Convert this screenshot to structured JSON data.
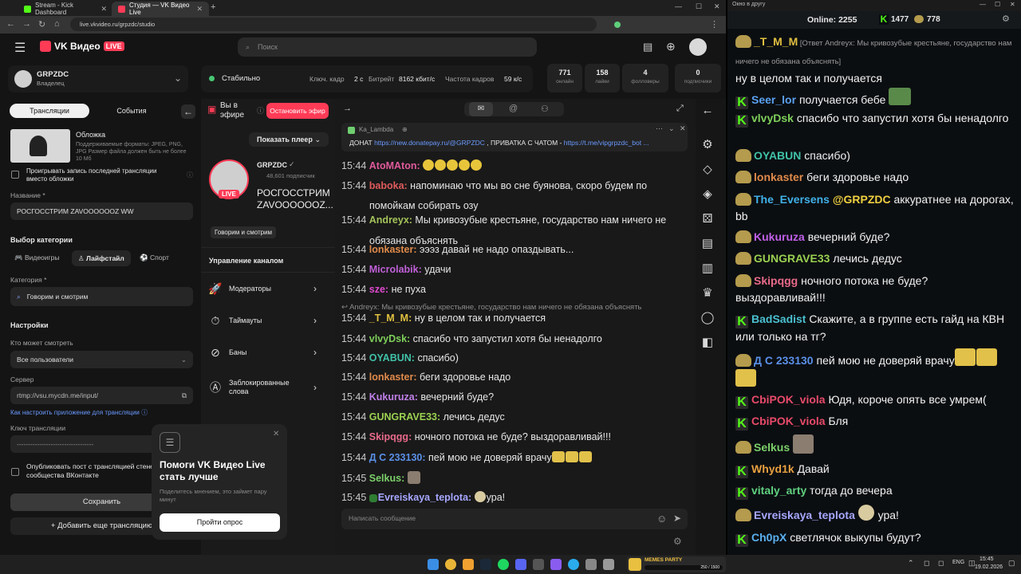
{
  "browser": {
    "tabs": [
      {
        "title": "Stream - Kick Dashboard",
        "color": "#53fc18"
      },
      {
        "title": "Студия — VK Видео Live",
        "color": "#ff3b56"
      }
    ],
    "url": "live.vkvideo.ru/grpzdc/studio"
  },
  "header": {
    "logo_text": "VK Видео",
    "live_badge": "LIVE",
    "search_placeholder": "Поиск"
  },
  "channel_card": {
    "name": "GRPZDC",
    "role": "Владелец"
  },
  "status": {
    "state": "Стабильно",
    "keyframe_label": "Ключ. кадр",
    "keyframe_value": "2 с",
    "bitrate_label": "Битрейт",
    "bitrate_value": "8162 кбит/с",
    "fps_label": "Частота кадров",
    "fps_value": "59 к/с"
  },
  "stats": [
    {
      "value": "771",
      "label": "онлайн"
    },
    {
      "value": "158",
      "label": "лайки"
    },
    {
      "value": "4",
      "label": "фолловеры"
    },
    {
      "value": "0",
      "label": "подписчики"
    }
  ],
  "left": {
    "tab_streams": "Трансляции",
    "tab_events": "События",
    "cover_title": "Обложка",
    "cover_desc": "Поддерживаемые форматы: JPEG, PNG, JPG Размер файла должен быть не более 10 Мб",
    "replay_checkbox": "Проигрывать запись последней трансляции вместо обложки",
    "name_label": "Название *",
    "name_value": "РОСГОССТРИМ ZAVOOOOOOZ WW",
    "category_title": "Выбор категории",
    "cat_games": "Видеоигры",
    "cat_life": "Лайфстайл",
    "cat_sport": "Спорт",
    "category_label": "Категория *",
    "category_value": "Говорим и смотрим",
    "settings_title": "Настройки",
    "who_label": "Кто может смотреть",
    "who_value": "Все пользователи",
    "server_label": "Сервер",
    "server_value": "rtmp://vsu.mycdn.me/input/",
    "howto_link": "Как настроить приложение для трансляции",
    "key_label": "Ключ трансляции",
    "key_value": "----------------------------------",
    "publish_checkbox": "Опубликовать пост с трансляцией стене сообщества ВКонтакте",
    "save_button": "Сохранить",
    "add_stream": "Добавить еще трансляцию"
  },
  "mid": {
    "live_label": "Вы в эфире",
    "stop_button": "Остановить эфир",
    "show_player": "Показать плеер",
    "channel": "GRPZDC",
    "subs": "48,601 подписчик",
    "stream_title": "РОСГОССТРИМ ZAVOOOOOOZ...",
    "live": "LIVE",
    "category_tag": "Говорим и смотрим",
    "manage_title": "Управление каналом",
    "menu": [
      "Модераторы",
      "Таймауты",
      "Баны",
      "Заблокированные слова"
    ]
  },
  "survey": {
    "title": "Помоги VK Видео Live стать лучше",
    "desc": "Поделитесь мнением, это займет пару минут",
    "button": "Пройти опрос"
  },
  "vkchat": {
    "pinned_author": "Ka_Lambda",
    "pinned_text_a": "ДОНАТ ",
    "pinned_link_a": "https://new.donatepay.ru/@GRPZDC",
    "pinned_text_b": " , ПРИВАТКА С ЧАТОМ - ",
    "pinned_link_b": "https://t.me/vipgrpzdc_bot ...",
    "reply_preview": "Andreyx: Мы кривозубые крестьяне, государство нам ничего не обязана объяснять",
    "input_placeholder": "Написать сообщение",
    "messages": [
      {
        "time": "15:44",
        "user": "AtoMAton:",
        "color": "#e15a9c",
        "text": ""
      },
      {
        "time": "15:44",
        "user": "baboka:",
        "color": "#e05b5b",
        "text": "напоминаю что мы во сне буянова, скоро будем по"
      },
      {
        "time": "",
        "user": "",
        "color": "#e05b5b",
        "text": "помойкам собирать озу"
      },
      {
        "time": "15:44",
        "user": "Andreyx:",
        "color": "#a4c35a",
        "text": "Мы кривозубые крестьяне, государство нам ничего не"
      },
      {
        "time": "",
        "user": "",
        "color": "#a4c35a",
        "text": "обязана объяснять"
      },
      {
        "time": "15:44",
        "user": "lonkaster:",
        "color": "#e08a4a",
        "text": "эээз давай не надо опаздывать..."
      },
      {
        "time": "15:44",
        "user": "Microlabik:",
        "color": "#c060d8",
        "text": "удачи"
      },
      {
        "time": "15:44",
        "user": "sze:",
        "color": "#e04ad0",
        "text": "не пуха"
      },
      {
        "time": "15:44",
        "user": "_T_M_M:",
        "color": "#e0c040",
        "text": "ну в целом так и получается"
      },
      {
        "time": "15:44",
        "user": "vlvyDsk:",
        "color": "#7ecf5a",
        "text": "спасибо что запустил хотя бы ненадолго"
      },
      {
        "time": "15:44",
        "user": "OYABUN:",
        "color": "#40c2a8",
        "text": "спасибо)"
      },
      {
        "time": "15:44",
        "user": "lonkaster:",
        "color": "#e08a4a",
        "text": "беги здоровье надо"
      },
      {
        "time": "15:44",
        "user": "Kukuruza:",
        "color": "#c080e8",
        "text": "вечерний буде?"
      },
      {
        "time": "15:44",
        "user": "GUNGRAVE33:",
        "color": "#9ad050",
        "text": "лечись дедус"
      },
      {
        "time": "15:44",
        "user": "Skipqgg:",
        "color": "#e86a8a",
        "text": "ночного потока не буде? выздоравливай!!!"
      },
      {
        "time": "15:44",
        "user": "Д С 233130:",
        "color": "#5a90e8",
        "text": "пей мою не доверяй врачу"
      },
      {
        "time": "15:45",
        "user": "Selkus:",
        "color": "#7bcf6a",
        "text": ""
      },
      {
        "time": "15:45",
        "user": "Evreiskaya_teplota:",
        "color": "#a7a7ff",
        "text": "ура!"
      }
    ]
  },
  "kick": {
    "window_title": "Окно в другу",
    "online_label": "Online:",
    "online_value": "2255",
    "count_a": "1477",
    "count_b": "778",
    "messages": [
      {
        "user": "_T_M_M",
        "color": "#e0c040",
        "reply": "[Ответ Andreyx: Мы кривозубые крестьяне, государство нам ничего не обязана объяснять]",
        "text": "ну в целом так и получается"
      },
      {
        "user": "Seer_lor",
        "color": "#5aa0f0",
        "text": "получается бебе"
      },
      {
        "user": "vlvyDsk",
        "color": "#7ecf5a",
        "text": "спасибо что запустил хотя бы ненадолго"
      },
      {
        "user": "OYABUN",
        "color": "#40c2a8",
        "text": "спасибо)"
      },
      {
        "user": "lonkaster",
        "color": "#e08a4a",
        "text": "беги здоровье надо"
      },
      {
        "user": "The_Eversens",
        "color": "#40b0e8",
        "text": "@GRPZDC аккуратнее на дорогах, bb"
      },
      {
        "user": "Kukuruza",
        "color": "#c060e8",
        "text": "вечерний буде?"
      },
      {
        "user": "GUNGRAVE33",
        "color": "#9ad050",
        "text": "лечись дедус"
      },
      {
        "user": "Skipqgg",
        "color": "#e86a8a",
        "text": "ночного потока не буде? выздоравливай!!!"
      },
      {
        "user": "BadSadist",
        "color": "#4ac0d0",
        "text": "Скажите, а в группе есть гайд на КВН или только на тг?"
      },
      {
        "user": "Д С 233130",
        "color": "#5a90e8",
        "text": "пей мою не доверяй врачу"
      },
      {
        "user": "CbiPOK_viola",
        "color": "#e84a6a",
        "text": "Юдя, короче опять все умрем("
      },
      {
        "user": "CbiPOK_viola",
        "color": "#e84a6a",
        "text": "Бля"
      },
      {
        "user": "Selkus",
        "color": "#7bcf6a",
        "text": ""
      },
      {
        "user": "Whyd1k",
        "color": "#e8a040",
        "text": "Давай"
      },
      {
        "user": "vitaly_arty",
        "color": "#60d080",
        "text": "тогда до вечера"
      },
      {
        "user": "Evreiskaya_teplota",
        "color": "#a7a7ff",
        "text": "ура!"
      },
      {
        "user": "Ch0pX",
        "color": "#5ab0f0",
        "text": "светлячок выкупы будут?"
      }
    ]
  },
  "taskbar": {
    "lang": "ENG",
    "time": "15:45",
    "date": "19.02.2026",
    "memes_label": "MEMES PARTY",
    "memes_count": "250 / 1500"
  }
}
